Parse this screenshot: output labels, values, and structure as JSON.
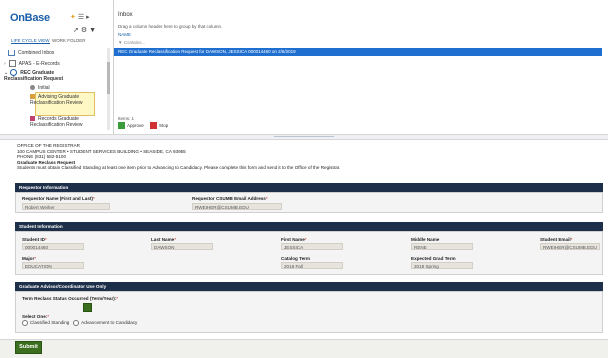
{
  "app": {
    "logo_main": "OnBase",
    "view_tab_lifecycle": "LIFE CYCLE VIEW",
    "view_tab_workfolder": "WORK FOLDER"
  },
  "tree": [
    {
      "label": "Combined Inbox"
    },
    {
      "label": "APAS - E-Records"
    },
    {
      "label": "REC Graduate Reclassification Request"
    },
    {
      "label": "Initial"
    },
    {
      "label": "Advising Graduate Reclassification Review"
    },
    {
      "label": "Records Graduate Reclassification Review"
    }
  ],
  "inbox": {
    "title": "Inbox",
    "hint": "Drag a column header here to group by that column.",
    "column_name": "NAME",
    "filter_placeholder": "Contains...",
    "selected_row": "REC Graduate Reclassification Request for DAWSON, JESSICA 000014460 on 2/6/2019",
    "items_count": "Items: 1",
    "approve_label": "Approve",
    "stop_label": "Stop"
  },
  "form": {
    "header_lines": [
      "OFFICE OF THE REGISTRAR",
      "100 CAMPUS CENTER • STUDENT SERVICES BUILDING • SEASIDE, CA 93955",
      "PHONE (831) 582-5100"
    ],
    "form_title": "Graduate Reclass Request",
    "instructions": "Students must obtain Classified Standing at least one item prior to Advancing to Candidacy. Please complete this form and send it to the Office of the Registrar.",
    "requestor_section": "Requestor Information",
    "requestor_name_label": "Requestor Name (First and Last)",
    "requestor_name_value": "Robert Weiher",
    "requestor_email_label": "Requestor CSUMB Email Address",
    "requestor_email_value": "RWEIHER@CSUMB.EDU",
    "student_section": "Student Information",
    "student_id_label": "Student ID",
    "student_id_value": "000014460",
    "last_name_label": "Last Name",
    "last_name_value": "DAWSON",
    "first_name_label": "First Name",
    "first_name_value": "JESSICA",
    "middle_name_label": "Middle Name",
    "middle_name_value": "RENE",
    "student_email_label": "Student Email",
    "student_email_value": "RWEIHER@CSUMB.EDU",
    "major_label": "Major",
    "major_value": "EDUCATION",
    "catalog_term_label": "Catalog Term",
    "catalog_term_value": "2018 Fall",
    "grad_term_label": "Expected Grad Term",
    "grad_term_value": "2019 Spring",
    "advisor_section": "Graduate Advisor/Coordinator Use Only",
    "term_label": "Term Reclass Status Occurred (Term/Year):",
    "select_one_label": "Select One:",
    "option_classified": "Classified Standing",
    "option_advancement": "Advancement to Candidacy",
    "submit_label": "Submit"
  },
  "colors": {
    "accent": "#1a5fa8",
    "selected_row": "#1f6fd0",
    "section_bar": "#1e2f4a",
    "submit": "#3b6e1e"
  }
}
